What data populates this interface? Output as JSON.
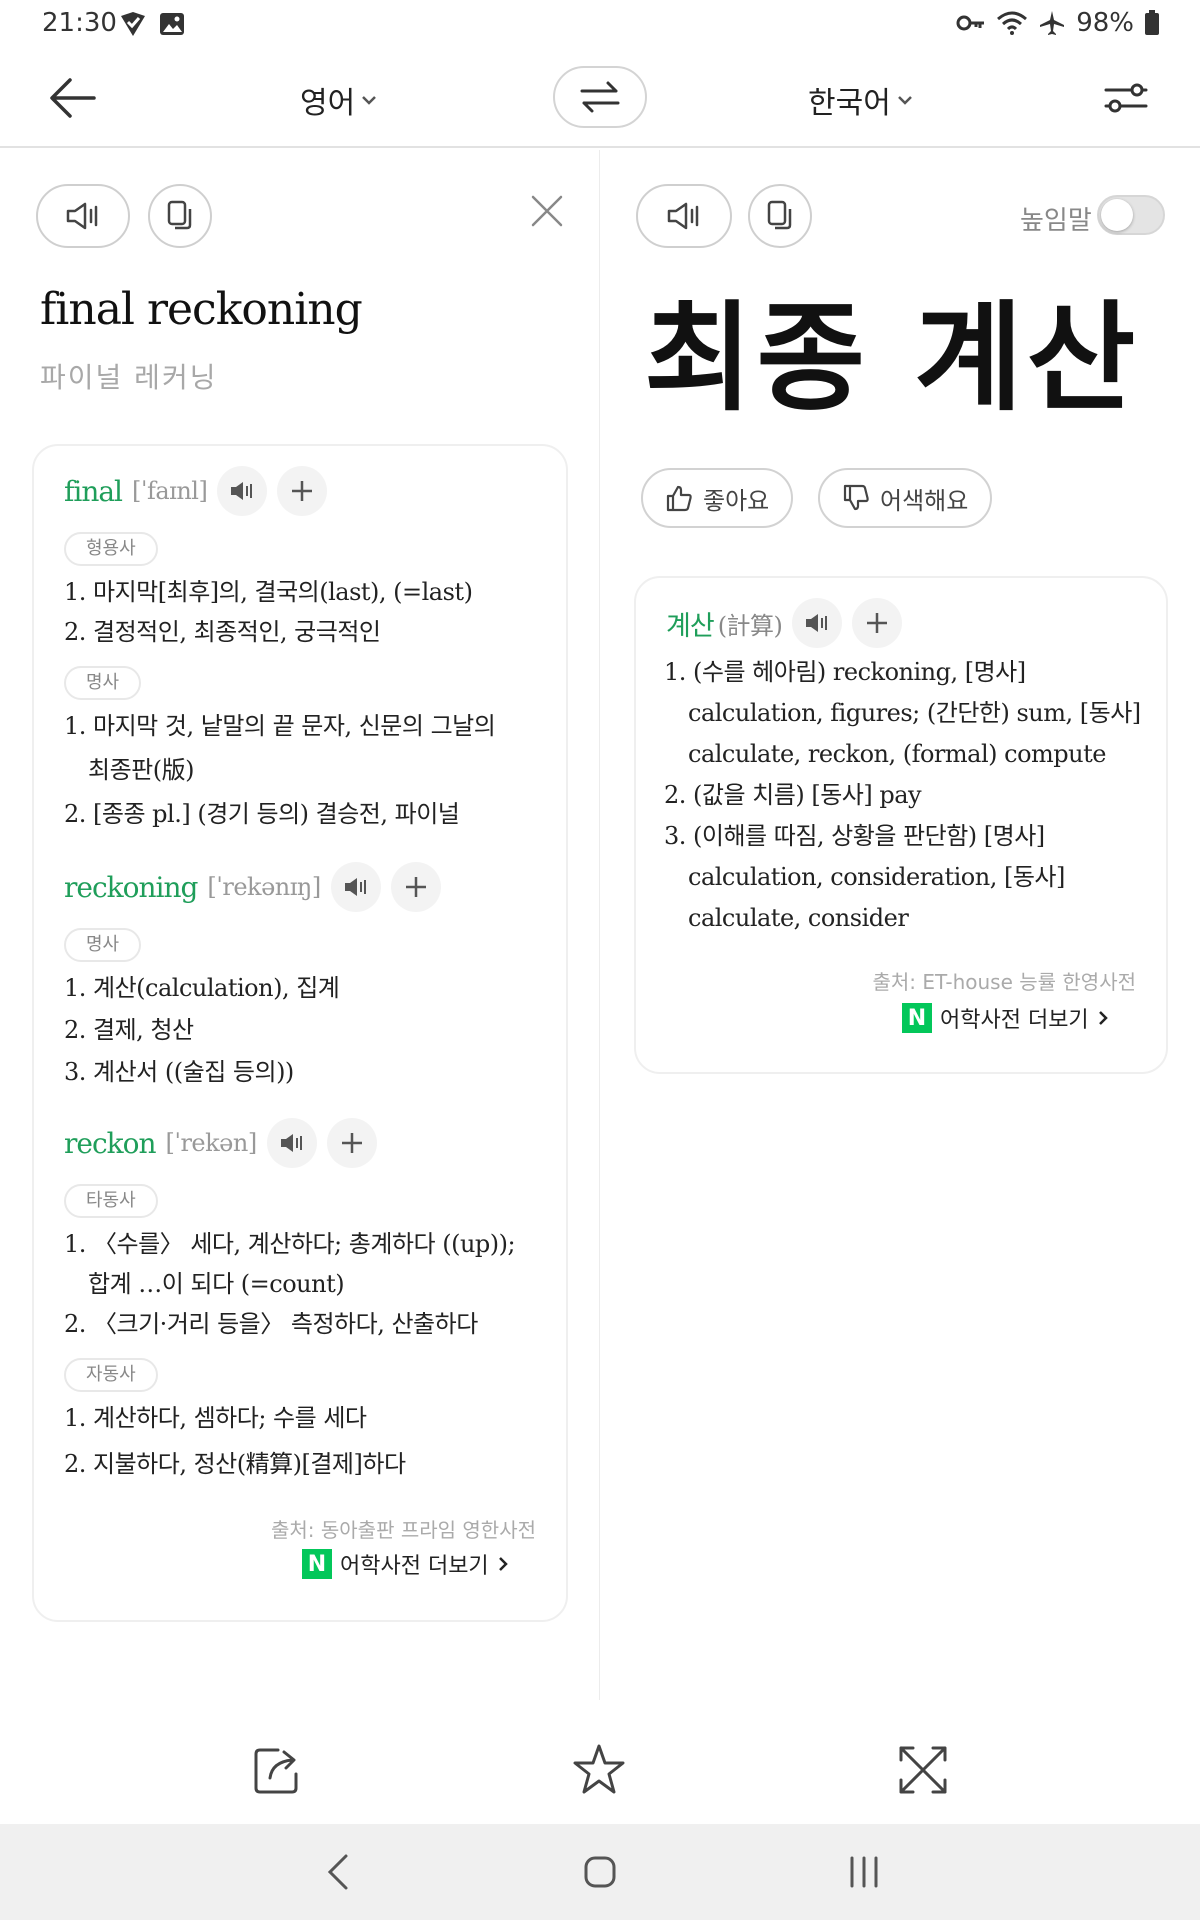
{
  "status_bar": {
    "time": "21:30",
    "battery": "98%",
    "icons": [
      "verified-icon",
      "image-icon",
      "key-icon",
      "wifi-icon",
      "airplane-icon",
      "battery-icon"
    ]
  },
  "top_bar": {
    "source_lang": "영어",
    "target_lang": "한국어"
  },
  "source_pane": {
    "text": "final reckoning",
    "pronunciation": "파이널 레커닝"
  },
  "target_pane": {
    "formal_label": "높임말",
    "formal_on": false,
    "text": "최종 계산",
    "like_label": "좋아요",
    "awkward_label": "어색해요"
  },
  "left_dictionary": {
    "entries": [
      {
        "word": "final",
        "phonetic": "[ˈfaɪnl]",
        "groups": [
          {
            "pos": "형용사",
            "defs": [
              "1. 마지막[최후]의, 결국의(last), (=last)",
              "2. 결정적인, 최종적인, 궁극적인"
            ]
          },
          {
            "pos": "명사",
            "defs": [
              "1. 마지막 것, 낱말의 끝 문자, 신문의 그날의",
              "최종판(版)",
              "2. [종종 pl.] (경기 등의) 결승전, 파이널"
            ]
          }
        ]
      },
      {
        "word": "reckoning",
        "phonetic": "[ˈrekənɪŋ]",
        "groups": [
          {
            "pos": "명사",
            "defs": [
              "1. 계산(calculation), 집계",
              "2. 결제, 청산",
              "3. 계산서 ((술집 등의))"
            ]
          }
        ]
      },
      {
        "word": "reckon",
        "phonetic": "[ˈrekən]",
        "groups": [
          {
            "pos": "타동사",
            "defs": [
              "1. 〈수를〉 세다, 계산하다; 총계하다 ((up));",
              "합계 …이 되다 (=count)",
              "2. 〈크기·거리 등을〉 측정하다, 산출하다"
            ]
          },
          {
            "pos": "자동사",
            "defs": [
              "1. 계산하다, 셈하다; 수를 세다",
              "2. 지불하다, 정산(精算)[결제]하다"
            ]
          }
        ]
      }
    ],
    "source": "출처: 동아출판 프라임 영한사전",
    "more_label": "어학사전 더보기"
  },
  "right_dictionary": {
    "word": "계산",
    "hanja": "(計算)",
    "defs": [
      "1. (수를 헤아림) reckoning, [명사]",
      "calculation, figures; (간단한) sum, [동사]",
      "calculate, reckon, (formal) compute",
      "2. (값을 치름) [동사] pay",
      "3. (이해를 따짐, 상황을 판단함) [명사]",
      "calculation, consideration, [동사]",
      "calculate, consider"
    ],
    "source": "출처: ET-house 능률 한영사전",
    "more_label": "어학사전 더보기"
  },
  "colors": {
    "accent_green": "#1f9e5a",
    "naver_green": "#03c75a"
  }
}
